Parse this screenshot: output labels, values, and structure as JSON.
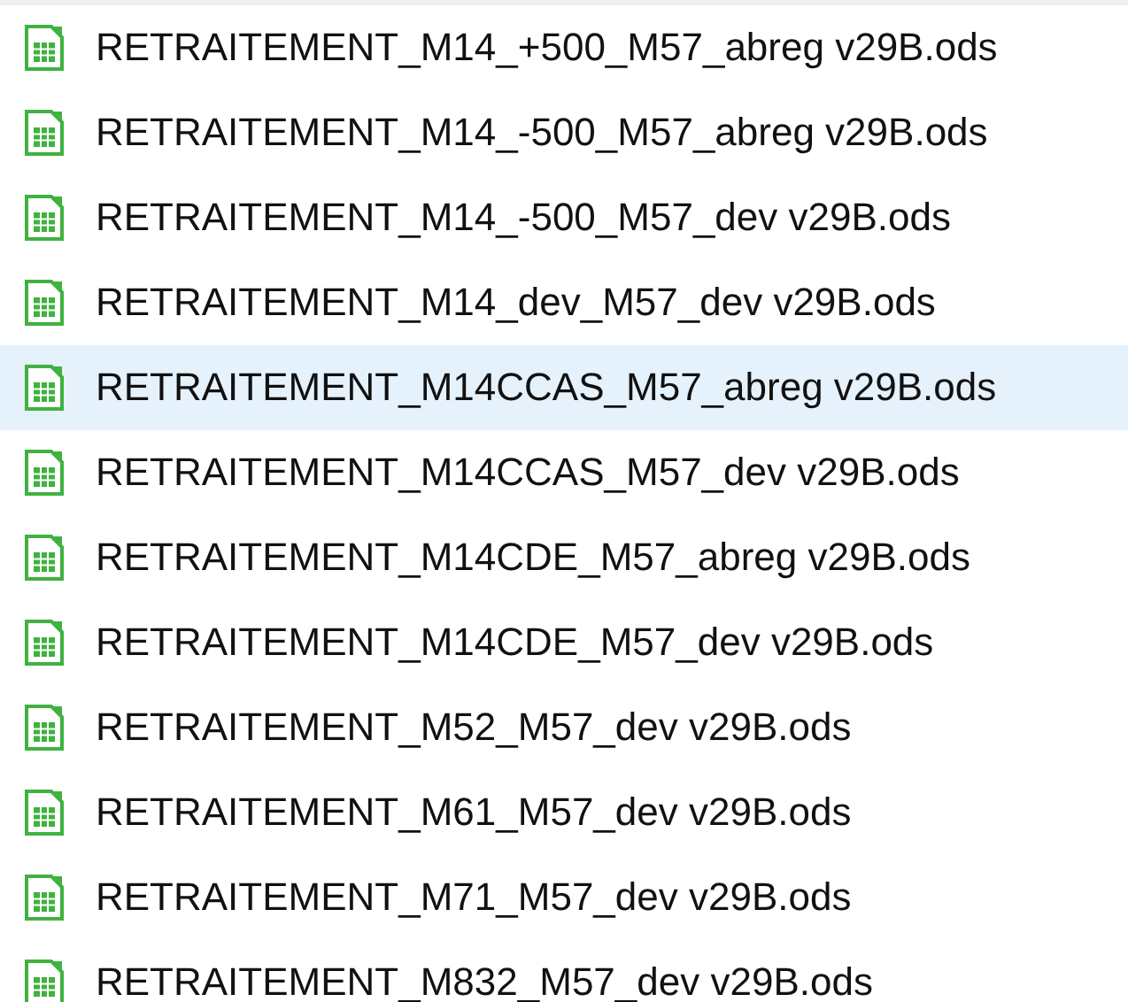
{
  "files": [
    {
      "name": "RETRAITEMENT_M14_+500_M57_abreg v29B.ods",
      "selected": false
    },
    {
      "name": "RETRAITEMENT_M14_-500_M57_abreg v29B.ods",
      "selected": false
    },
    {
      "name": "RETRAITEMENT_M14_-500_M57_dev v29B.ods",
      "selected": false
    },
    {
      "name": "RETRAITEMENT_M14_dev_M57_dev v29B.ods",
      "selected": false
    },
    {
      "name": "RETRAITEMENT_M14CCAS_M57_abreg v29B.ods",
      "selected": true
    },
    {
      "name": "RETRAITEMENT_M14CCAS_M57_dev v29B.ods",
      "selected": false
    },
    {
      "name": "RETRAITEMENT_M14CDE_M57_abreg v29B.ods",
      "selected": false
    },
    {
      "name": "RETRAITEMENT_M14CDE_M57_dev v29B.ods",
      "selected": false
    },
    {
      "name": "RETRAITEMENT_M52_M57_dev v29B.ods",
      "selected": false
    },
    {
      "name": "RETRAITEMENT_M61_M57_dev v29B.ods",
      "selected": false
    },
    {
      "name": "RETRAITEMENT_M71_M57_dev v29B.ods",
      "selected": false
    },
    {
      "name": "RETRAITEMENT_M832_M57_dev v29B.ods",
      "selected": false
    }
  ]
}
